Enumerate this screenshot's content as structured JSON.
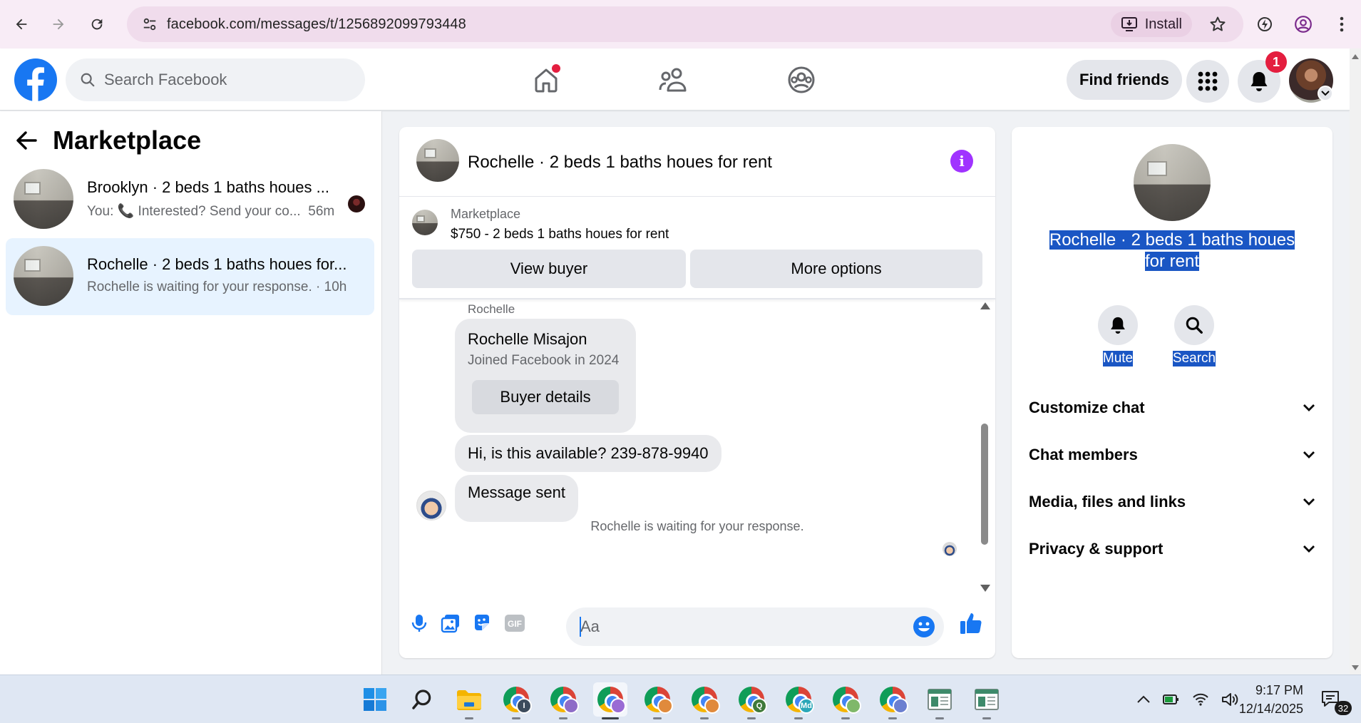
{
  "browser": {
    "url": "facebook.com/messages/t/1256892099793448",
    "install_label": "Install"
  },
  "facebook": {
    "search_placeholder": "Search Facebook",
    "find_friends_label": "Find friends",
    "notification_count": "1"
  },
  "sidebar": {
    "title": "Marketplace",
    "conversations": [
      {
        "title": "Brooklyn · 2 beds 1 baths houes ...",
        "preview": "You: 📞 Interested? Send your co...",
        "time": "56m",
        "active": false
      },
      {
        "title": "Rochelle · 2 beds 1 baths houes for...",
        "preview": "Rochelle is waiting for your response. · 10h",
        "time": "",
        "active": true
      }
    ]
  },
  "chat": {
    "title": "Rochelle · 2 beds 1 baths houes for rent",
    "listing": {
      "label": "Marketplace",
      "price_title": "$750 - 2 beds 1 baths houes for rent"
    },
    "view_buyer_label": "View buyer",
    "more_options_label": "More options",
    "sender_label": "Rochelle",
    "buyer_card": {
      "name": "Rochelle Misajon",
      "joined": "Joined Facebook in 2024",
      "button_label": "Buyer details"
    },
    "messages": [
      {
        "text": "Hi, is this available? 239-878-9940"
      },
      {
        "text": "Message sent"
      }
    ],
    "waiting_text": "Rochelle is waiting for your response.",
    "composer_placeholder": "Aa"
  },
  "info_panel": {
    "title": "Rochelle · 2 beds 1 baths houes for rent",
    "title_line1": "Rochelle · 2 beds 1 baths houes",
    "title_line2": "for rent",
    "mute_label": "Mute",
    "search_label": "Search",
    "sections": [
      {
        "label": "Customize chat"
      },
      {
        "label": "Chat members"
      },
      {
        "label": "Media, files and links"
      },
      {
        "label": "Privacy & support"
      }
    ]
  },
  "taskbar": {
    "time": "9:17 PM",
    "date": "12/14/2025",
    "notification_count": "32",
    "chrome_badges": [
      "I",
      "",
      "",
      "",
      "",
      "Q",
      "Md",
      "",
      ""
    ]
  },
  "colors": {
    "facebook_blue": "#1877f2",
    "active_conversation": "#e7f3ff",
    "info_purple": "#a033ff",
    "notification_red": "#e41e3f",
    "selection_blue": "#1a56c4"
  }
}
